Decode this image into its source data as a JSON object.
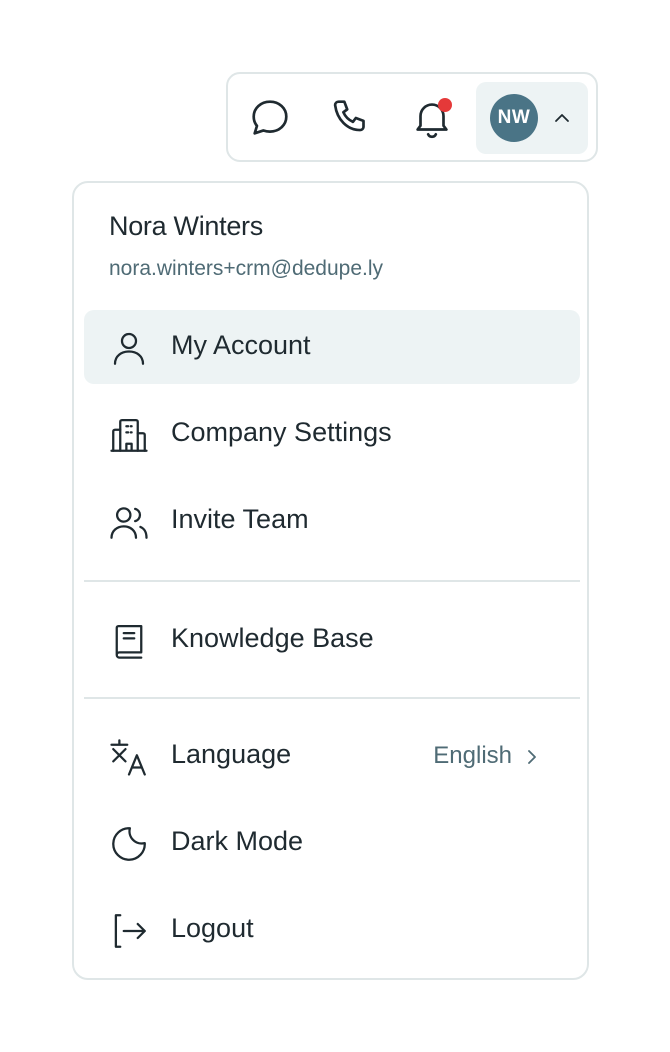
{
  "topbar": {
    "chat_icon": "chat-bubble-icon",
    "phone_icon": "phone-icon",
    "bell_icon": "bell-icon",
    "has_notification": true,
    "avatar_initials": "NW",
    "avatar_color": "#4a7486",
    "chevron_icon": "chevron-up-icon"
  },
  "user": {
    "name": "Nora Winters",
    "email": "nora.winters+crm@dedupe.ly"
  },
  "menu": {
    "my_account": {
      "label": "My Account",
      "icon": "user-icon",
      "active": true
    },
    "company_settings": {
      "label": "Company Settings",
      "icon": "building-icon"
    },
    "invite_team": {
      "label": "Invite Team",
      "icon": "users-icon"
    },
    "knowledge_base": {
      "label": "Knowledge Base",
      "icon": "book-icon"
    },
    "language": {
      "label": "Language",
      "value": "English",
      "icon": "translate-icon"
    },
    "dark_mode": {
      "label": "Dark Mode",
      "icon": "moon-icon"
    },
    "logout": {
      "label": "Logout",
      "icon": "logout-icon"
    }
  },
  "colors": {
    "accent": "#4a7486",
    "active_bg": "#edf3f4",
    "notification": "#e53939",
    "border": "#dfe6e7"
  }
}
